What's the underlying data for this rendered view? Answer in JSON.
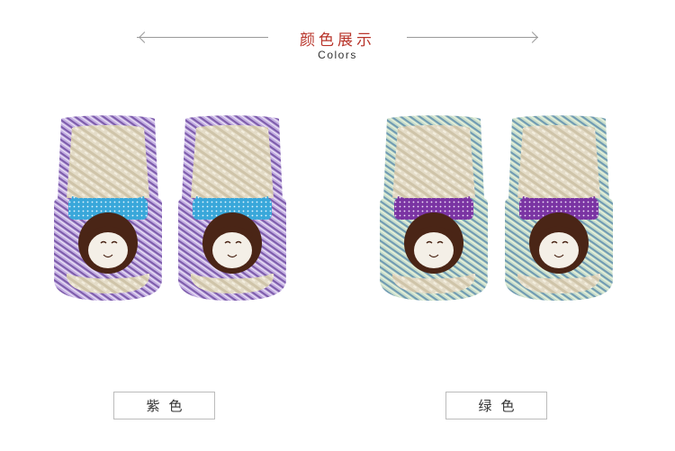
{
  "header": {
    "title_cn": "颜色展示",
    "title_en": "Colors"
  },
  "colors": {
    "accent_title": "#b8342a"
  },
  "variants": [
    {
      "label": "紫色",
      "swatch": "#b49ad6"
    },
    {
      "label": "绿色",
      "swatch": "#a8c8b4"
    }
  ]
}
